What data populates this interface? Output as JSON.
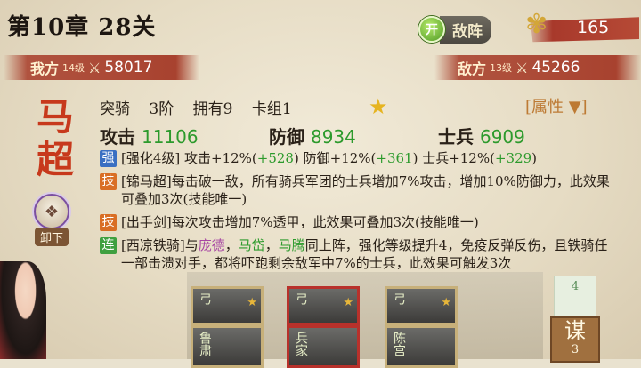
{
  "header": {
    "chapter": "第10章 28关",
    "enemy_icon": "开",
    "enemy_label": "敌阵",
    "food_value": "165"
  },
  "power": {
    "ally_label": "我方",
    "ally_level": "14级",
    "ally_power": "58017",
    "enemy_label": "敌方",
    "enemy_level": "13级",
    "enemy_power": "45266"
  },
  "hero": {
    "name_char1": "马",
    "name_char2": "超",
    "unequip_label": "卸下",
    "unit_type": "突骑",
    "tier": "3阶",
    "owned": "拥有9",
    "deck": "卡组1",
    "attr_label": "[属性 ▼]"
  },
  "stats": {
    "attack_label": "攻击",
    "attack_value": "11106",
    "defense_label": "防御",
    "defense_value": "8934",
    "troops_label": "士兵",
    "troops_value": "6909"
  },
  "skills": [
    {
      "tag": "强",
      "text_a": "[强化4级]  攻击+12%(",
      "bonus1": "+528",
      "text_b": ")  防御+12%(",
      "bonus2": "+361",
      "text_c": ")  士兵+12%(",
      "bonus3": "+329",
      "text_d": ")"
    },
    {
      "tag": "技",
      "text": "[锦马超]每击破一敌，所有骑兵军团的士兵增加7%攻击，增加10%防御力，此效果可叠加3次(技能唯一)"
    },
    {
      "tag": "技",
      "text": "[出手剑]每次攻击增加7%透甲，此效果可叠加3次(技能唯一)"
    },
    {
      "tag": "连",
      "text_a": "[西凉铁骑]与",
      "p1": "庞德",
      "sep1": "，",
      "p2": "马岱",
      "sep2": "，",
      "p3": "马腾",
      "text_b": "同上阵，强化等级提升4，免疫反弹反伤，且铁骑任一部击溃对手，都将吓跑剩余敌军中7%的士兵，此效果可触发3次"
    }
  ],
  "cards": [
    {
      "label": "弓"
    },
    {
      "label": "弓"
    },
    {
      "label": "弓"
    },
    {
      "label": "鲁肃"
    },
    {
      "label": "兵家"
    },
    {
      "label": "陈宫"
    }
  ],
  "side": {
    "count1": "4",
    "mou_label": "谋",
    "mou_count": "3"
  }
}
